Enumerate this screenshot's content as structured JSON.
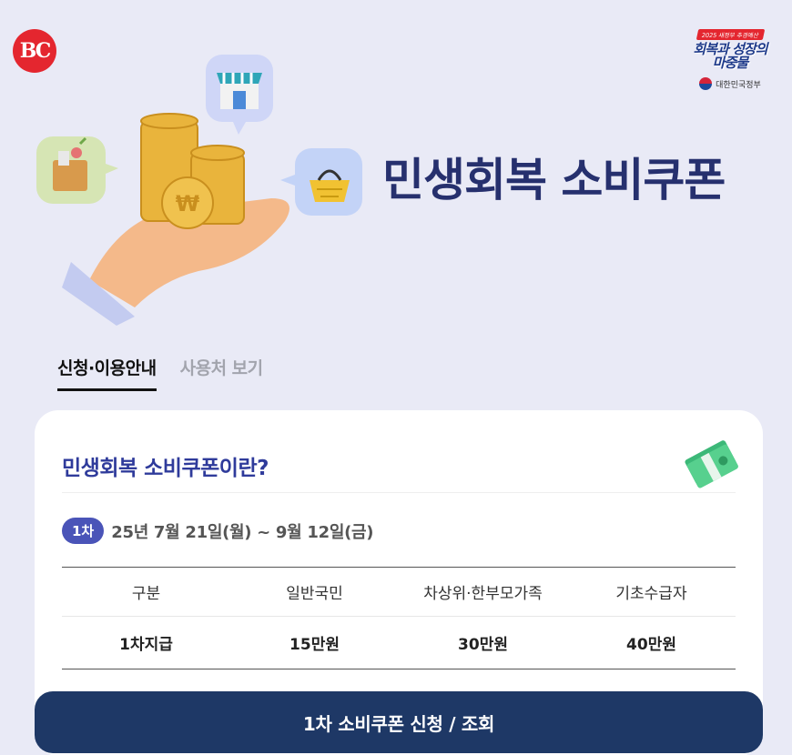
{
  "brand": {
    "logo_text": "BC"
  },
  "gov_badge": {
    "tag": "2025 새정부 추경예산",
    "slogan_line1": "회복과 성장의",
    "slogan_line2": "마중물",
    "org": "대한민국정부"
  },
  "hero": {
    "title": "민생회복 소비쿠폰"
  },
  "tabs": [
    {
      "label": "신청·이용안내",
      "active": true
    },
    {
      "label": "사용처 보기",
      "active": false
    }
  ],
  "card": {
    "title": "민생회복 소비쿠폰이란?",
    "round_badge": "1차",
    "period": "25년 7월 21일(월) ~ 9월 12일(금)",
    "table": {
      "headers": [
        "구분",
        "일반국민",
        "차상위·한부모가족",
        "기초수급자"
      ],
      "rows": [
        [
          "1차지급",
          "15만원",
          "30만원",
          "40만원"
        ]
      ]
    }
  },
  "cta": {
    "label": "1차 소비쿠폰 신청 / 조회"
  },
  "colors": {
    "accent": "#2f3b9b",
    "button": "#1e3866",
    "logo": "#e4262f",
    "background": "#e9eaf6"
  }
}
